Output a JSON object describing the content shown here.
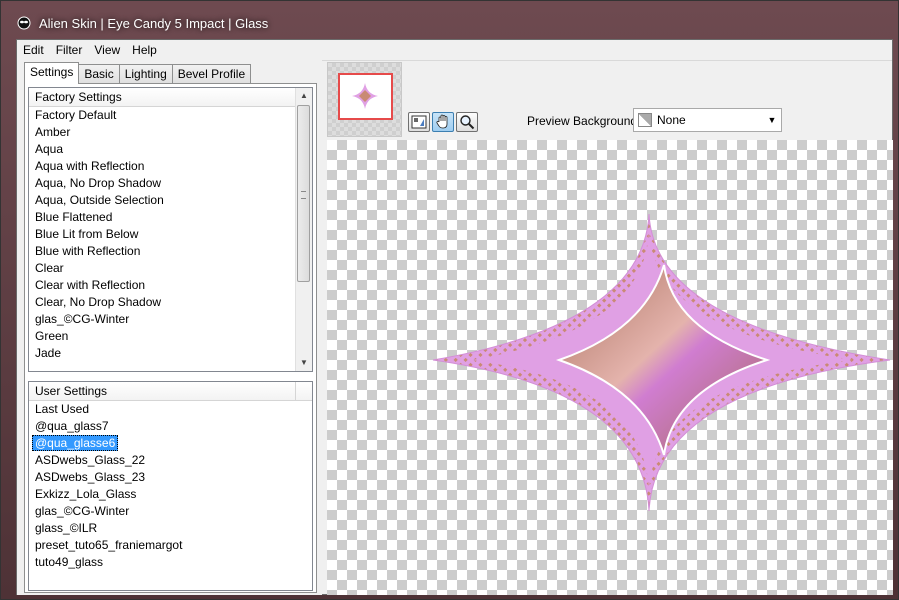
{
  "window": {
    "title": "Alien Skin | Eye Candy 5 Impact | Glass"
  },
  "menu": [
    "Edit",
    "Filter",
    "View",
    "Help"
  ],
  "tabs": [
    "Settings",
    "Basic",
    "Lighting",
    "Bevel Profile"
  ],
  "factory": {
    "header": "Factory Settings",
    "items": [
      "Factory Default",
      "Amber",
      "Aqua",
      "Aqua with Reflection",
      "Aqua, No Drop Shadow",
      "Aqua, Outside Selection",
      "Blue Flattened",
      "Blue Lit from Below",
      "Blue with Reflection",
      "Clear",
      "Clear with Reflection",
      "Clear, No Drop Shadow",
      "glas_©CG-Winter",
      "Green",
      "Jade"
    ]
  },
  "user": {
    "header": "User Settings",
    "items": [
      "Last Used",
      "@qua_glass7",
      "@qua_glasse6",
      "ASDwebs_Glass_22",
      "ASDwebs_Glass_23",
      "Exkizz_Lola_Glass",
      "glas_©CG-Winter",
      "glass_©ILR",
      "preset_tuto65_franiemargot",
      "tuto49_glass"
    ],
    "selected_index": 2
  },
  "preview_background": {
    "label": "Preview Background:",
    "value": "None"
  },
  "icons": {
    "app": "alien-skin-icon",
    "tools": [
      "preview-toggle-icon",
      "hand-icon",
      "zoom-icon"
    ]
  },
  "colors": {
    "accent": "#3399ff",
    "shape_outer": "#e0a0e4",
    "shape_inner": "#c98a74",
    "nav_frame": "#e64a4a"
  }
}
